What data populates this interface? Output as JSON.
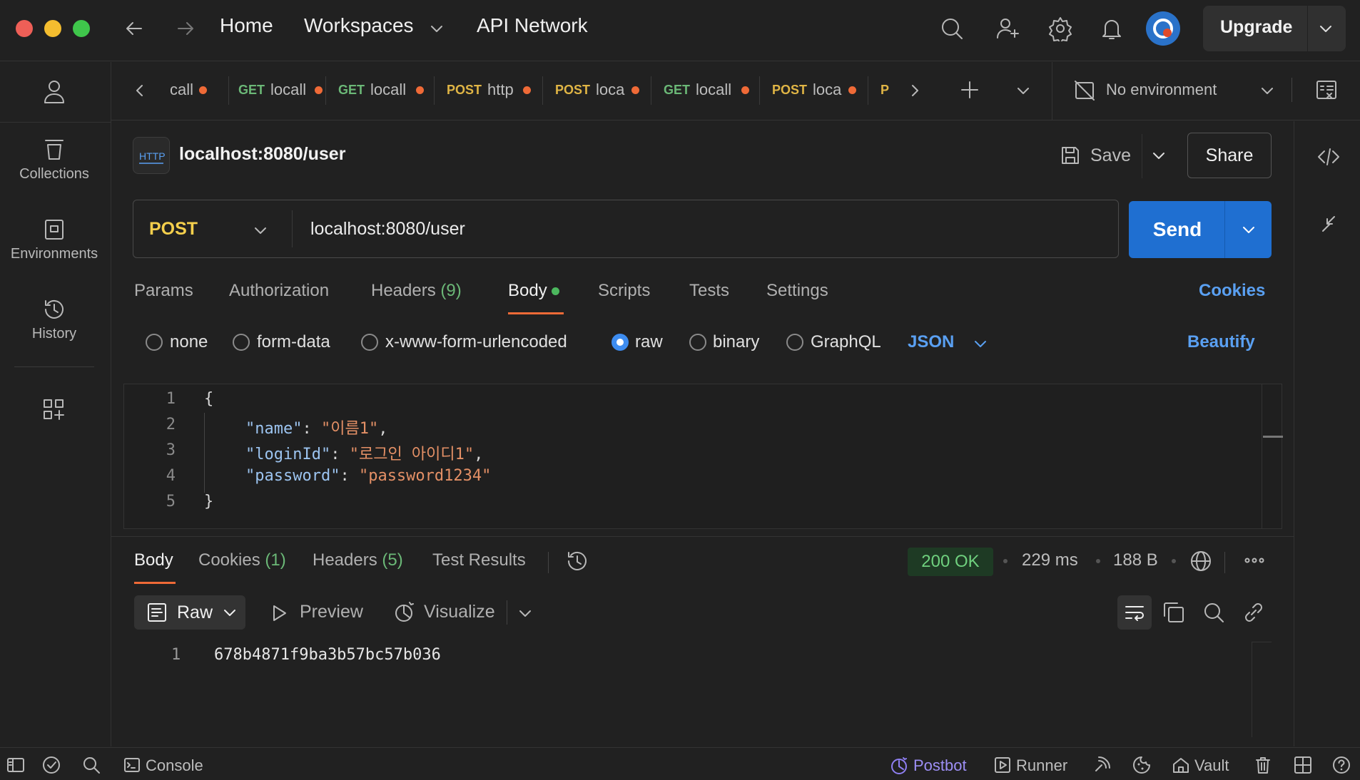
{
  "topbar": {
    "nav": {
      "home": "Home",
      "workspaces": "Workspaces",
      "api_network": "API Network"
    },
    "upgrade_label": "Upgrade"
  },
  "tabs": [
    {
      "method": "",
      "title": "call"
    },
    {
      "method": "GET",
      "title": "locall"
    },
    {
      "method": "GET",
      "title": "locall"
    },
    {
      "method": "POST",
      "title": "http"
    },
    {
      "method": "POST",
      "title": "loca"
    },
    {
      "method": "GET",
      "title": "locall"
    },
    {
      "method": "POST",
      "title": "loca"
    },
    {
      "method": "P",
      "title": ""
    }
  ],
  "environment": {
    "label": "No environment"
  },
  "sidebar": {
    "items": [
      {
        "label": "Collections",
        "icon": "collections-icon"
      },
      {
        "label": "Environments",
        "icon": "environments-icon"
      },
      {
        "label": "History",
        "icon": "history-icon"
      }
    ]
  },
  "request": {
    "badge": "HTTP",
    "name": "localhost:8080/user",
    "save_label": "Save",
    "share_label": "Share",
    "method": "POST",
    "url": "localhost:8080/user",
    "send_label": "Send",
    "tabs": {
      "params": "Params",
      "authorization": "Authorization",
      "headers": "Headers",
      "headers_count": "(9)",
      "body": "Body",
      "scripts": "Scripts",
      "tests": "Tests",
      "settings": "Settings",
      "cookies": "Cookies"
    },
    "body_types": {
      "none": "none",
      "form_data": "form-data",
      "urlencoded": "x-www-form-urlencoded",
      "raw": "raw",
      "binary": "binary",
      "graphql": "GraphQL",
      "format": "JSON",
      "beautify": "Beautify",
      "selected": "raw"
    },
    "code_lines": [
      {
        "n": "1",
        "open": "{"
      },
      {
        "n": "2",
        "key": "\"name\"",
        "colon": ": ",
        "value": "\"이름1\"",
        "comma": ","
      },
      {
        "n": "3",
        "key": "\"loginId\"",
        "colon": ": ",
        "value": "\"로그인 아이디1\"",
        "comma": ","
      },
      {
        "n": "4",
        "key": "\"password\"",
        "colon": ": ",
        "value": "\"password1234\"",
        "comma": ""
      },
      {
        "n": "5",
        "close": "}"
      }
    ]
  },
  "response": {
    "tabs": {
      "body": "Body",
      "cookies": "Cookies",
      "cookies_count": "(1)",
      "headers": "Headers",
      "headers_count": "(5)",
      "test_results": "Test Results"
    },
    "status": "200 OK",
    "time": "229 ms",
    "size": "188 B",
    "view": {
      "raw": "Raw",
      "preview": "Preview",
      "visualize": "Visualize"
    },
    "lines": [
      {
        "n": "1",
        "text": "678b4871f9ba3b57bc57b036"
      }
    ]
  },
  "statusbar": {
    "console": "Console",
    "postbot": "Postbot",
    "runner": "Runner",
    "vault": "Vault"
  },
  "colors": {
    "accent": "#1f6fd1",
    "link": "#5aa0f2",
    "get": "#6bb877",
    "post": "#e0b545",
    "status_ok": "#6fd07e",
    "unsaved_dot": "#ef6a37"
  }
}
